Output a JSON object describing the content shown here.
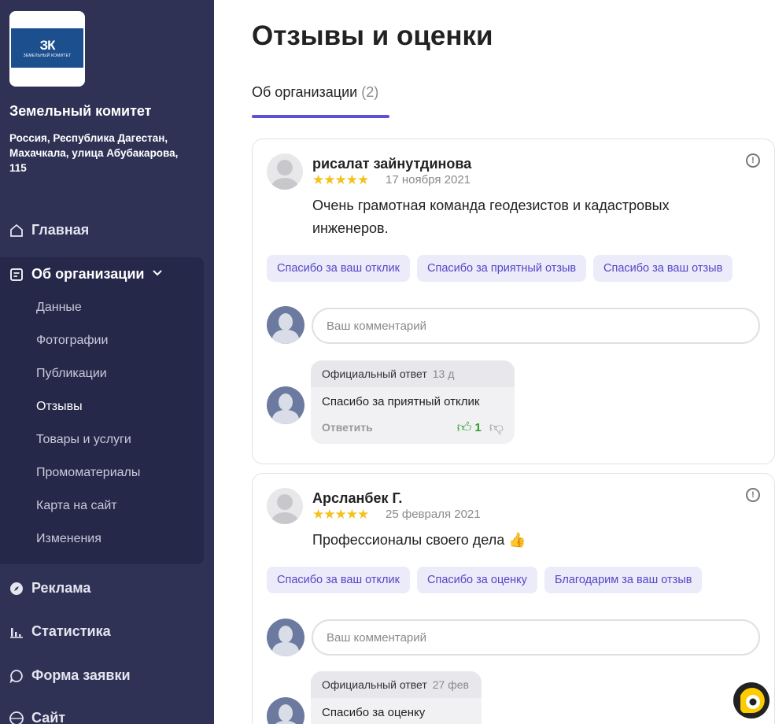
{
  "sidebar": {
    "logo_mark": "ЗК",
    "logo_text": "ЗЕМЕЛЬНЫЙ КОМИТЕТ",
    "org_name": "Земельный комитет",
    "org_address": "Россия, Республика Дагестан, Махачкала, улица Абубакарова, 115",
    "nav": {
      "home": "Главная",
      "about": "Об организации",
      "ads": "Реклама",
      "stats": "Статистика",
      "form": "Форма заявки",
      "site": "Сайт"
    },
    "submenu": [
      "Данные",
      "Фотографии",
      "Публикации",
      "Отзывы",
      "Товары и услуги",
      "Промоматериалы",
      "Карта на сайт",
      "Изменения"
    ],
    "active_sub": "Отзывы"
  },
  "main": {
    "title": "Отзывы и оценки",
    "tab_label": "Об организации",
    "tab_count": "(2)"
  },
  "reviews": [
    {
      "author": "рисалат зайнутдинова",
      "stars": "★★★★★",
      "rating": 5,
      "date": "17 ноября 2021",
      "text": "Очень грамотная команда геодезистов и кадастровых инженеров.",
      "chips": [
        "Спасибо за ваш отклик",
        "Спасибо за приятный отзыв",
        "Спасибо за ваш отзыв"
      ],
      "comment_placeholder": "Ваш комментарий",
      "reply": {
        "label": "Официальный ответ",
        "age": "13 д",
        "text": "Спасибо за приятный отклик",
        "action": "Ответить",
        "likes": "1"
      }
    },
    {
      "author": "Арсланбек Г.",
      "stars": "★★★★★",
      "rating": 5,
      "date": "25 февраля 2021",
      "text": "Профессионалы своего дела 👍",
      "chips": [
        "Спасибо за ваш отклик",
        "Спасибо за оценку",
        "Благодарим за ваш отзыв"
      ],
      "comment_placeholder": "Ваш комментарий",
      "reply": {
        "label": "Официальный ответ",
        "age": "27 фев",
        "text": "Спасибо за оценку"
      }
    }
  ],
  "colors": {
    "sidebar_bg": "#2f3155",
    "accent": "#6050d8",
    "chip_bg": "#ebebfa",
    "star": "#f5c11a",
    "like": "#2a9c2a"
  },
  "icons": {
    "home": "home-icon",
    "about": "document-icon",
    "ads": "compass-icon",
    "stats": "bar-chart-icon",
    "form": "chat-bubble-icon",
    "site": "globe-icon",
    "report": "exclamation-circle-icon",
    "like": "thumbs-up-icon",
    "dislike": "thumbs-down-icon"
  }
}
